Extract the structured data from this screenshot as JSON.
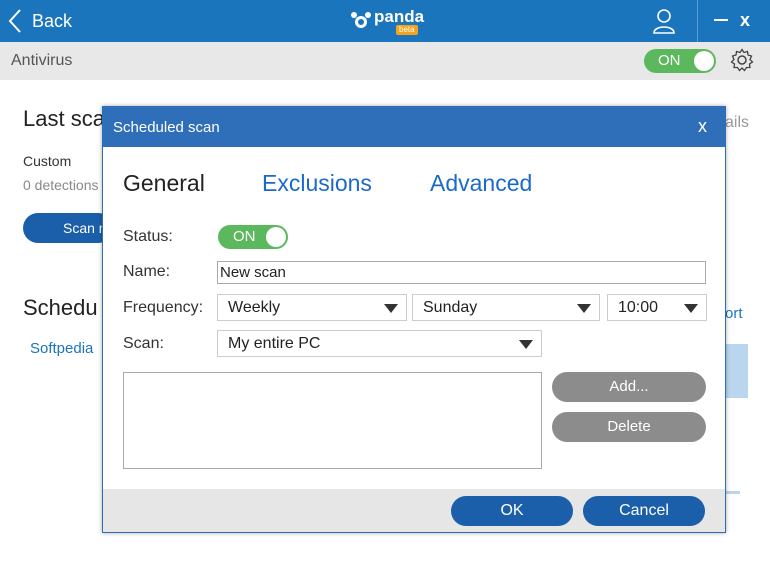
{
  "topbar": {
    "back_label": "Back",
    "logo_text": "panda",
    "logo_badge": "beta",
    "close_glyph": "x",
    "bg_color": "#1b75bc"
  },
  "subbar": {
    "title": "Antivirus",
    "toggle_label": "ON"
  },
  "background": {
    "last_scan_heading": "Last sca",
    "custom_label": "Custom",
    "detections": "0 detections",
    "scan_button": "Scan n",
    "scheduled_heading": "Schedu",
    "scheduled_item": "Softpedia",
    "details_link": "ails",
    "report_link": "ort"
  },
  "dialog": {
    "title": "Scheduled scan",
    "close_glyph": "x",
    "tabs": [
      {
        "label": "General",
        "active": true
      },
      {
        "label": "Exclusions",
        "active": false
      },
      {
        "label": "Advanced",
        "active": false
      }
    ],
    "status_label": "Status:",
    "status_toggle": "ON",
    "name_label": "Name:",
    "name_value": "New scan",
    "frequency_label": "Frequency:",
    "frequency_value": "Weekly",
    "day_value": "Sunday",
    "time_value": "10:00",
    "scan_label": "Scan:",
    "scan_value": "My entire PC",
    "add_button": "Add...",
    "delete_button": "Delete",
    "ok_button": "OK",
    "cancel_button": "Cancel",
    "header_color": "#2f6fba",
    "accent_color": "#1b5fab",
    "toggle_color": "#5cb85c"
  }
}
